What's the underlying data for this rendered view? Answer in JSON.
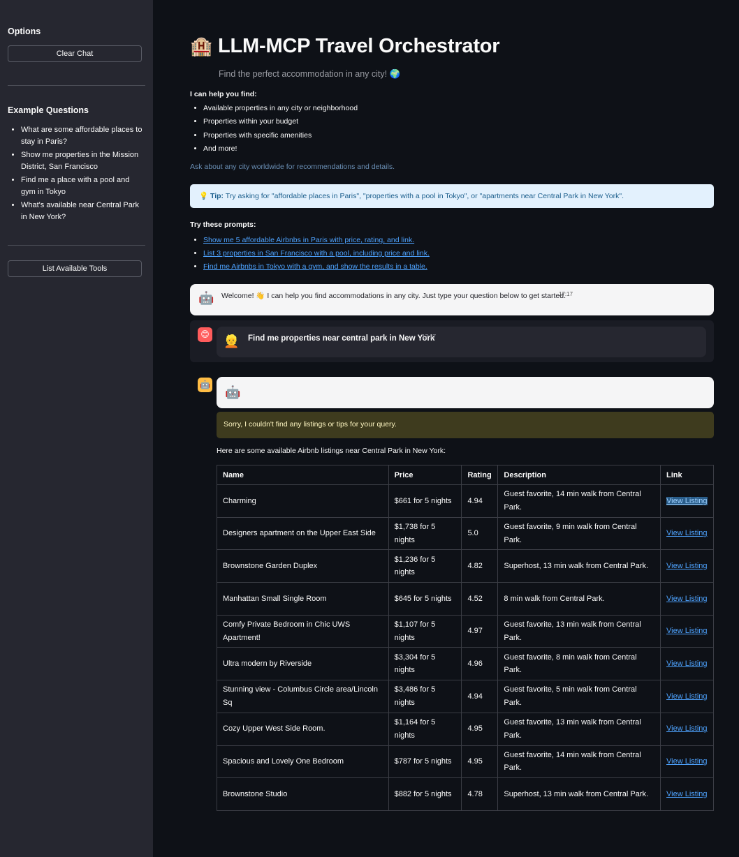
{
  "sidebar": {
    "options_heading": "Options",
    "clear_chat": "Clear Chat",
    "examples_heading": "Example Questions",
    "examples": [
      "What are some affordable places to stay in Paris?",
      "Show me properties in the Mission District, San Francisco",
      "Find me a place with a pool and gym in Tokyo",
      "What's available near Central Park in New York?"
    ],
    "list_tools": "List Available Tools"
  },
  "header": {
    "emoji": "🏨",
    "title": "LLM-MCP Travel Orchestrator",
    "subtitle": "Find the perfect accommodation in any city! 🌍"
  },
  "help": {
    "heading": "I can help you find:",
    "items": [
      "Available properties in any city or neighborhood",
      "Properties within your budget",
      "Properties with specific amenities",
      "And more!"
    ],
    "ask": "Ask about any city worldwide for recommendations and details."
  },
  "tip": {
    "icon": "💡",
    "label": "Tip:",
    "text": "Try asking for \"affordable places in Paris\", \"properties with a pool in Tokyo\", or \"apartments near Central Park in New York\"."
  },
  "prompts": {
    "heading": "Try these prompts:",
    "items": [
      "Show me 5 affordable Airbnbs in Paris with price, rating, and link.",
      "List 3 properties in San Francisco with a pool, including price and link.",
      "Find me Airbnbs in Tokyo with a gym, and show the results in a table."
    ]
  },
  "chat": {
    "welcome": {
      "avatar": "🤖",
      "text": "Welcome! 👋 I can help you find accommodations in any city. Just type your question below to get started.",
      "time": "17:17"
    },
    "user": {
      "avatar": "😊",
      "face": "👱",
      "text": "Find me properties near central park in New York",
      "time": "17:17"
    },
    "assistant": {
      "avatar": "🤖",
      "bubble_icon": "🤖",
      "warning": "Sorry, I couldn't find any listings or tips for your query.",
      "intro": "Here are some available Airbnb listings near Central Park in New York:"
    }
  },
  "table": {
    "headers": [
      "Name",
      "Price",
      "Rating",
      "Description",
      "Link"
    ],
    "rows": [
      [
        "Charming",
        "$661 for 5 nights",
        "4.94",
        "Guest favorite, 14 min walk from Central Park.",
        "View Listing"
      ],
      [
        "Designers apartment on the Upper East Side",
        "$1,738 for 5 nights",
        "5.0",
        "Guest favorite, 9 min walk from Central Park.",
        "View Listing"
      ],
      [
        "Brownstone Garden Duplex",
        "$1,236 for 5 nights",
        "4.82",
        "Superhost, 13 min walk from Central Park.",
        "View Listing"
      ],
      [
        "Manhattan Small Single Room",
        "$645 for 5 nights",
        "4.52",
        "8 min walk from Central Park.",
        "View Listing"
      ],
      [
        "Comfy Private Bedroom in Chic UWS Apartment!",
        "$1,107 for 5 nights",
        "4.97",
        "Guest favorite, 13 min walk from Central Park.",
        "View Listing"
      ],
      [
        "Ultra modern by Riverside",
        "$3,304 for 5 nights",
        "4.96",
        "Guest favorite, 8 min walk from Central Park.",
        "View Listing"
      ],
      [
        "Stunning view - Columbus Circle area/Lincoln Sq",
        "$3,486 for 5 nights",
        "4.94",
        "Guest favorite, 5 min walk from Central Park.",
        "View Listing"
      ],
      [
        "Cozy Upper West Side Room.",
        "$1,164 for 5 nights",
        "4.95",
        "Guest favorite, 13 min walk from Central Park.",
        "View Listing"
      ],
      [
        "Spacious and Lovely One Bedroom",
        "$787 for 5 nights",
        "4.95",
        "Guest favorite, 14 min walk from Central Park.",
        "View Listing"
      ],
      [
        "Brownstone Studio",
        "$882 for 5 nights",
        "4.78",
        "Superhost, 13 min walk from Central Park.",
        "View Listing"
      ]
    ]
  }
}
